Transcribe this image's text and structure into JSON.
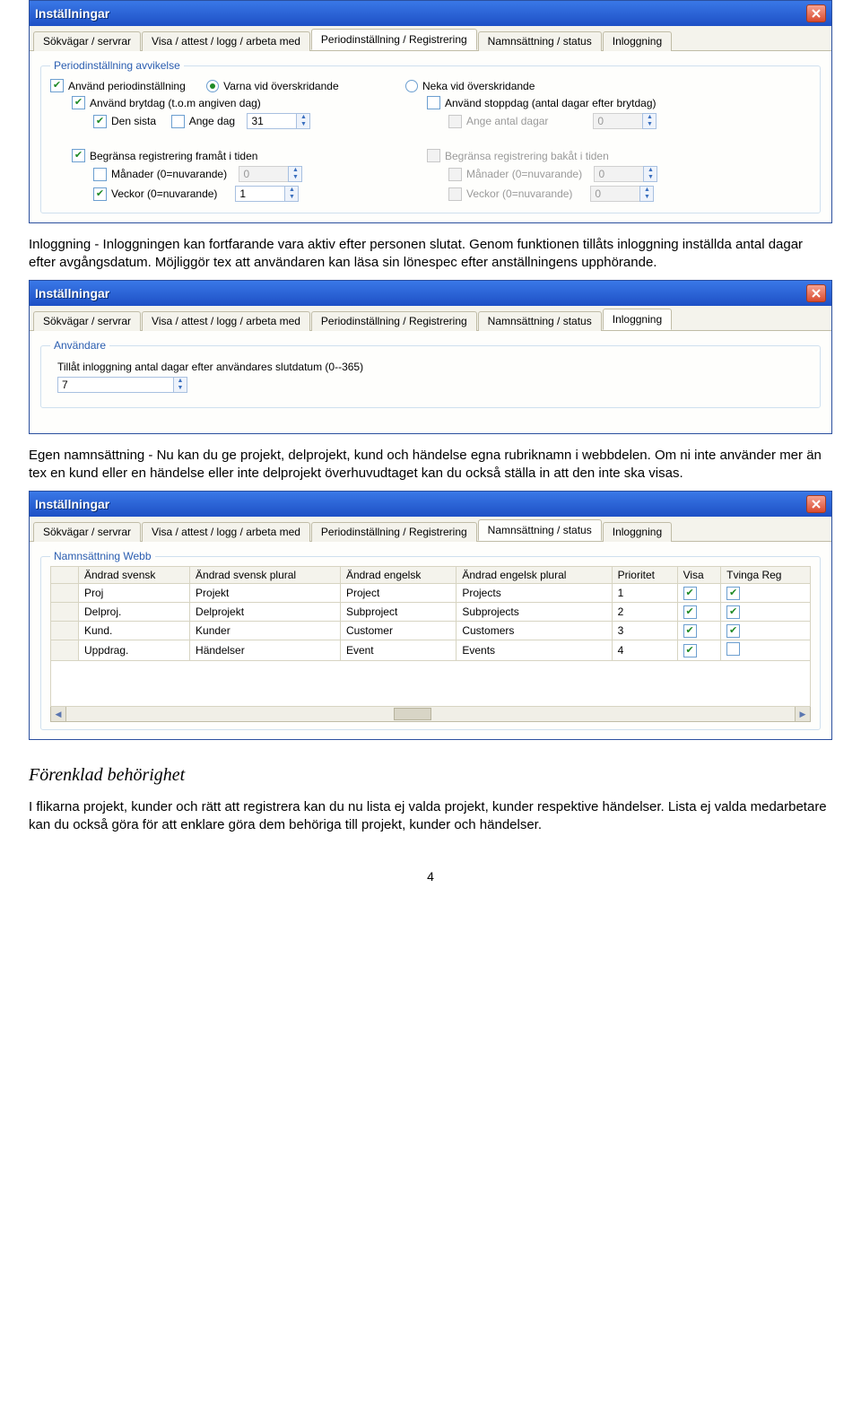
{
  "dialog_title": "Inställningar",
  "tabs": {
    "t1": "Sökvägar / servrar",
    "t2": "Visa / attest / logg / arbeta med",
    "t3": "Periodinställning / Registrering",
    "t4": "Namnsättning / status",
    "t5": "Inloggning"
  },
  "period": {
    "legend": "Periodinställning avvikelse",
    "use_period": "Använd periodinställning",
    "warn_over": "Varna vid överskridande",
    "deny_over": "Neka vid överskridande",
    "use_brytdag": "Använd brytdag (t.o.m angiven dag)",
    "use_stoppdag": "Använd stoppdag (antal dagar efter brytdag)",
    "den_sista": "Den sista",
    "ange_dag": "Ange dag",
    "ange_dag_val": "31",
    "ange_antal": "Ange antal dagar",
    "ange_antal_val": "0",
    "limit_fwd": "Begränsa registrering framåt i tiden",
    "limit_bwd": "Begränsa registrering bakåt i tiden",
    "months": "Månader (0=nuvarande)",
    "weeks": "Veckor (0=nuvarande)",
    "months_fwd_val": "0",
    "weeks_fwd_val": "1",
    "months_bwd_val": "0",
    "weeks_bwd_val": "0"
  },
  "para1": "Inloggning - Inloggningen kan fortfarande vara aktiv efter personen slutat. Genom funktionen tillåts inloggning inställda antal dagar efter avgångsdatum. Möjliggör tex att användaren kan läsa sin lönespec efter anställningens upphörande.",
  "login": {
    "legend": "Användare",
    "label": "Tillåt inloggning antal dagar efter användares slutdatum (0--365)",
    "value": "7"
  },
  "para2": "Egen namnsättning - Nu kan du ge projekt, delprojekt, kund och händelse egna rubriknamn i webbdelen. Om ni inte använder mer än tex en kund eller en händelse eller inte delprojekt överhuvudtaget kan du också ställa in att den inte ska visas.",
  "naming": {
    "legend": "Namnsättning Webb",
    "cols": {
      "c1": "Ändrad svensk",
      "c2": "Ändrad svensk plural",
      "c3": "Ändrad engelsk",
      "c4": "Ändrad engelsk plural",
      "c5": "Prioritet",
      "c6": "Visa",
      "c7": "Tvinga Reg"
    },
    "rows": [
      {
        "c1": "Proj",
        "c2": "Projekt",
        "c3": "Project",
        "c4": "Projects",
        "c5": "1",
        "c6": true,
        "c7": true
      },
      {
        "c1": "Delproj.",
        "c2": "Delprojekt",
        "c3": "Subproject",
        "c4": "Subprojects",
        "c5": "2",
        "c6": true,
        "c7": true
      },
      {
        "c1": "Kund.",
        "c2": "Kunder",
        "c3": "Customer",
        "c4": "Customers",
        "c5": "3",
        "c6": true,
        "c7": true
      },
      {
        "c1": "Uppdrag.",
        "c2": "Händelser",
        "c3": "Event",
        "c4": "Events",
        "c5": "4",
        "c6": true,
        "c7": false
      }
    ]
  },
  "h2": "Förenklad behörighet",
  "para3": "I flikarna projekt, kunder och rätt att registrera kan du nu lista ej valda projekt,  kunder respektive händelser. Lista ej valda medarbetare kan du också göra för att enklare göra dem behöriga till projekt, kunder och händelser.",
  "pagenum": "4"
}
